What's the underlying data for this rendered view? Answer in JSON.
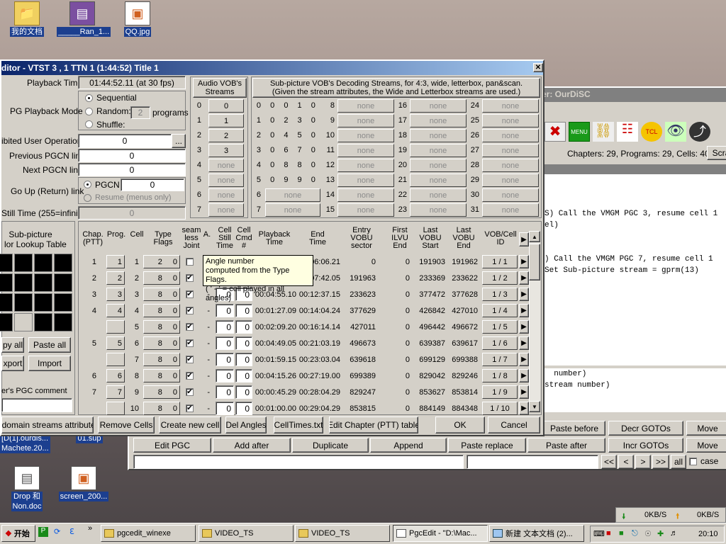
{
  "desktop_icons": [
    "我的文档",
    "_____Ran_1...",
    "QQ.jpg",
    "[D(1].ourdis...\nMachete.20...",
    "01.sup",
    "Drop 和\nNon.doc",
    "screen_200..."
  ],
  "bgwin": {
    "title": "er: OurDiSC",
    "stats": "Chapters: 29, Programs: 29, Cells: 40",
    "scr": "Scra",
    "code": [
      "S) Call the VMGM PGC 3, resume cell 1",
      "el)",
      "",
      "",
      ") Call the VMGM PGC 7, resume cell 1",
      "Set Sub-picture stream = gprm(13)"
    ],
    "code2": [
      "  number)",
      "stream number)"
    ],
    "btns_row1": [
      "Paste before",
      "Decr GOTOs",
      "Move"
    ],
    "btns_row2": [
      "Edit PGC",
      "Add after",
      "Duplicate",
      "Append",
      "Paste replace",
      "Paste after",
      "Incr GOTOs",
      "Move"
    ],
    "nav": [
      "<<",
      "<",
      ">",
      ">>",
      "all"
    ],
    "case": "case"
  },
  "dlg": {
    "title": "ditor - VTST 3 , 1   TTN 1  (1:44:52)  Title 1",
    "playback_time_label": "Playback Time",
    "playback_time": "01:44:52.11 (at 30 fps)",
    "pg_mode_label": "PG Playback Mode",
    "seq": "Sequential",
    "random": "Random:",
    "random_val": "2",
    "programs": "programs",
    "shuffle": "Shuffle:",
    "prohib_label": "ibited User Operations",
    "prohib_val": "0",
    "ellipsis": "...",
    "prev_label": "Previous PGCN link",
    "prev_val": "0",
    "next_label": "Next PGCN link",
    "next_val": "0",
    "goup_label": "Go Up (Return) link",
    "pgcn": "PGCN",
    "pgcn_val": "0",
    "resume": "Resume (menus only)",
    "still_label": "Still Time (255=infinite)",
    "still_val": "0",
    "subpic_label": "Sub-picture\nlor Lookup Table",
    "copy_all": "py all",
    "paste_all": "Paste all",
    "export": "xport",
    "import": "Import",
    "comment_label": "er's PGC comment",
    "audio_hdr": "Audio VOB's\nStreams",
    "audio": [
      [
        "0",
        "0"
      ],
      [
        "1",
        "1"
      ],
      [
        "2",
        "2"
      ],
      [
        "3",
        "3"
      ],
      [
        "4",
        "none"
      ],
      [
        "5",
        "none"
      ],
      [
        "6",
        "none"
      ],
      [
        "7",
        "none"
      ]
    ],
    "sub_hdr": "Sub-picture VOB's Decoding Streams, for 4:3, wide, letterbox, pan&scan.\n(Given the stream attributes, the Wide and Letterbox streams are used.)",
    "sub0": [
      [
        "0",
        "0 0 1 0"
      ],
      [
        "1",
        "0 2 3 0"
      ],
      [
        "2",
        "0 4 5 0"
      ],
      [
        "3",
        "0 6 7 0"
      ],
      [
        "4",
        "0 8 8 0"
      ],
      [
        "5",
        "0 9 9 0"
      ],
      [
        "6",
        "none"
      ],
      [
        "7",
        "none"
      ]
    ],
    "sub_rest_idx": [
      "8",
      "9",
      "10",
      "11",
      "12",
      "13",
      "14",
      "15",
      "16",
      "17",
      "18",
      "19",
      "20",
      "21",
      "22",
      "23",
      "24",
      "25",
      "26",
      "27",
      "28",
      "29",
      "30",
      "31"
    ],
    "none": "none",
    "cell_hdrs": [
      "Chap.\n(PTT)",
      "Prog.",
      "Cell",
      "Type\nFlags",
      "seam\nless\nJoint",
      "A.",
      "Cell\nStill\nTime",
      "Cell\nCmd\n#",
      "Playback\nTime",
      "End\nTime",
      "Entry\nVOBU\nsector",
      "First\nILVU\nEnd",
      "Last\nVOBU\nStart",
      "Last\nVOBU\nEnd",
      "VOB/Cell\nID"
    ],
    "rows": [
      [
        "1",
        "1",
        "1",
        "2 0",
        "",
        "",
        "",
        "",
        "",
        "06:06.21",
        "0",
        "0",
        "191903",
        "191962",
        "1 / 1"
      ],
      [
        "2",
        "2",
        "2",
        "8 0",
        "✔",
        "",
        "",
        "",
        "",
        "07:42.05",
        "191963",
        "0",
        "233369",
        "233622",
        "1 / 2"
      ],
      [
        "3",
        "3",
        "3",
        "8 0",
        "✔",
        "-",
        "0",
        "0",
        "00:04:55.10",
        "00:12:37.15",
        "233623",
        "0",
        "377472",
        "377628",
        "1 / 3"
      ],
      [
        "4",
        "4",
        "4",
        "8 0",
        "✔",
        "-",
        "0",
        "0",
        "00:01:27.09",
        "00:14:04.24",
        "377629",
        "0",
        "426842",
        "427010",
        "1 / 4"
      ],
      [
        "",
        "",
        "5",
        "8 0",
        "✔",
        "-",
        "0",
        "0",
        "00:02:09.20",
        "00:16:14.14",
        "427011",
        "0",
        "496442",
        "496672",
        "1 / 5"
      ],
      [
        "5",
        "5",
        "6",
        "8 0",
        "✔",
        "-",
        "0",
        "0",
        "00:04:49.05",
        "00:21:03.19",
        "496673",
        "0",
        "639387",
        "639617",
        "1 / 6"
      ],
      [
        "",
        "",
        "7",
        "8 0",
        "✔",
        "-",
        "0",
        "0",
        "00:01:59.15",
        "00:23:03.04",
        "639618",
        "0",
        "699129",
        "699388",
        "1 / 7"
      ],
      [
        "6",
        "6",
        "8",
        "8 0",
        "✔",
        "-",
        "0",
        "0",
        "00:04:15.26",
        "00:27:19.00",
        "699389",
        "0",
        "829042",
        "829246",
        "1 / 8"
      ],
      [
        "7",
        "7",
        "9",
        "8 0",
        "✔",
        "-",
        "0",
        "0",
        "00:00:45.29",
        "00:28:04.29",
        "829247",
        "0",
        "853627",
        "853814",
        "1 / 9"
      ],
      [
        "",
        "",
        "10",
        "8 0",
        "✔",
        "-",
        "0",
        "0",
        "00:01:00.00",
        "00:29:04.29",
        "853815",
        "0",
        "884149",
        "884348",
        "1 / 10"
      ]
    ],
    "tooltip": [
      "Angle number",
      "computed from the Type Flags.",
      "( ' - ' = cell played in all angles)"
    ],
    "bottom_btns": [
      "v domain streams attributes",
      "Remove Cells",
      "Create new cell",
      "Del Angles",
      "CellTimes.txt",
      "Edit Chapter (PTT) table",
      "OK",
      "Cancel"
    ]
  },
  "speed": {
    "down": "0KB/S",
    "up": "0KB/S"
  },
  "taskbar": {
    "start": "开始",
    "items": [
      "pgcedit_winexe",
      "VIDEO_TS",
      "VIDEO_TS",
      "PgcEdit - \"D:\\Mac...",
      "新建 文本文档 (2)..."
    ],
    "clock": "20:10"
  }
}
